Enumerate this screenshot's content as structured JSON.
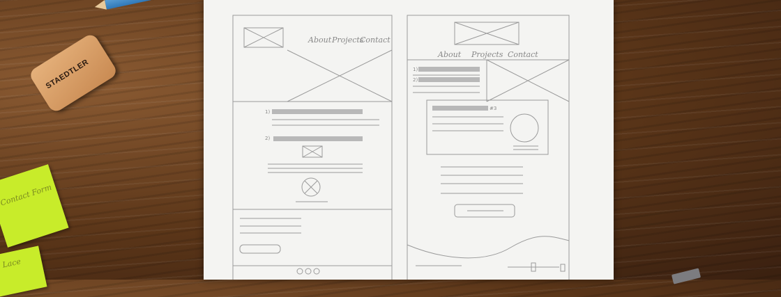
{
  "eraser": {
    "brand": "STAEDTLER"
  },
  "sticky_notes": [
    {
      "text": "Contact Form"
    },
    {
      "text": "Lace"
    }
  ],
  "wireframe_left": {
    "nav": [
      "About",
      "Projects",
      "Contact"
    ],
    "list_markers": [
      "1)",
      "2)"
    ]
  },
  "wireframe_right": {
    "nav": [
      "About",
      "Projects",
      "Contact"
    ],
    "list_markers": [
      "1)",
      "2)"
    ],
    "card_marker": "#3"
  }
}
